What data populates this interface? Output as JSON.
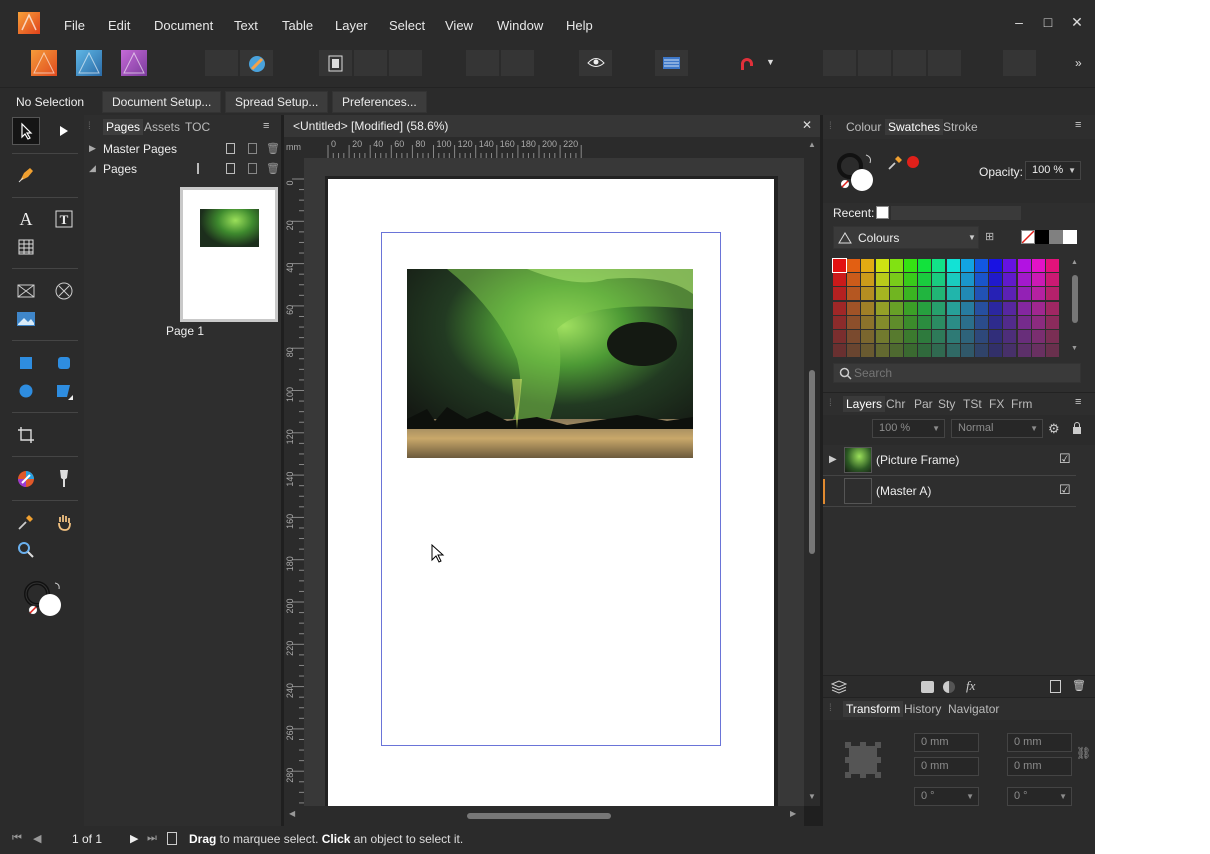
{
  "menu": [
    "File",
    "Edit",
    "Document",
    "Text",
    "Table",
    "Layer",
    "Select",
    "View",
    "Window",
    "Help"
  ],
  "window_controls": {
    "minimize": "–",
    "maximize": "□",
    "close": "✕"
  },
  "context": {
    "selection": "No Selection",
    "buttons": [
      "Document Setup...",
      "Spread Setup...",
      "Preferences..."
    ]
  },
  "pages_panel": {
    "tabs": [
      "Pages",
      "Assets",
      "TOC"
    ],
    "master_pages": "Master Pages",
    "pages": "Pages",
    "page1_label": "Page 1"
  },
  "document": {
    "tab_title": "<Untitled> [Modified] (58.6%)",
    "unit": "mm",
    "ruler_top": [
      "0",
      "20",
      "40",
      "60",
      "80",
      "100",
      "120",
      "140",
      "160",
      "180",
      "200",
      "220"
    ],
    "ruler_left": [
      "0",
      "20",
      "40",
      "60",
      "80",
      "100",
      "120",
      "140",
      "160",
      "180",
      "200",
      "220",
      "240",
      "260",
      "280"
    ]
  },
  "colour_panel": {
    "tabs": [
      "Colour",
      "Swatches",
      "Stroke"
    ],
    "opacity_label": "Opacity:",
    "opacity_value": "100 %",
    "recent_label": "Recent:",
    "palette_name": "Colours",
    "search_placeholder": "Search",
    "accent_red": "#e0201a"
  },
  "layers_panel": {
    "tabs": [
      "Layers",
      "Chr",
      "Par",
      "Sty",
      "TSt",
      "FX",
      "Frm"
    ],
    "opacity": "100 %",
    "blend_mode": "Normal",
    "layers": [
      {
        "name": "(Picture Frame)",
        "checked": "☑"
      },
      {
        "name": "(Master A)",
        "checked": "☑"
      }
    ]
  },
  "transform_panel": {
    "tabs": [
      "Transform",
      "History",
      "Navigator"
    ],
    "x": "0 mm",
    "w": "0 mm",
    "y": "0 mm",
    "h": "0 mm",
    "rotation": "0 °",
    "shear": "0 °"
  },
  "status": {
    "page_counter": "1 of 1",
    "hint_bold1": "Drag",
    "hint_text1": " to marquee select. ",
    "hint_bold2": "Click",
    "hint_text2": " an object to select it."
  },
  "icons": [
    "affinity-publisher-logo",
    "photo-persona-icon",
    "designer-persona-icon",
    "publisher-persona-icon",
    "move-tool-icon",
    "pen-tool-icon",
    "text-tool-icon",
    "frame-text-icon",
    "table-icon",
    "picture-frame-icon",
    "cross-frame-icon",
    "image-icon",
    "rectangle-icon",
    "rounded-rect-icon",
    "ellipse-icon",
    "shape-icon",
    "crop-icon",
    "colour-picker-icon",
    "fill-icon",
    "eyedropper-icon",
    "hand-icon",
    "zoom-icon",
    "magnet-icon"
  ]
}
